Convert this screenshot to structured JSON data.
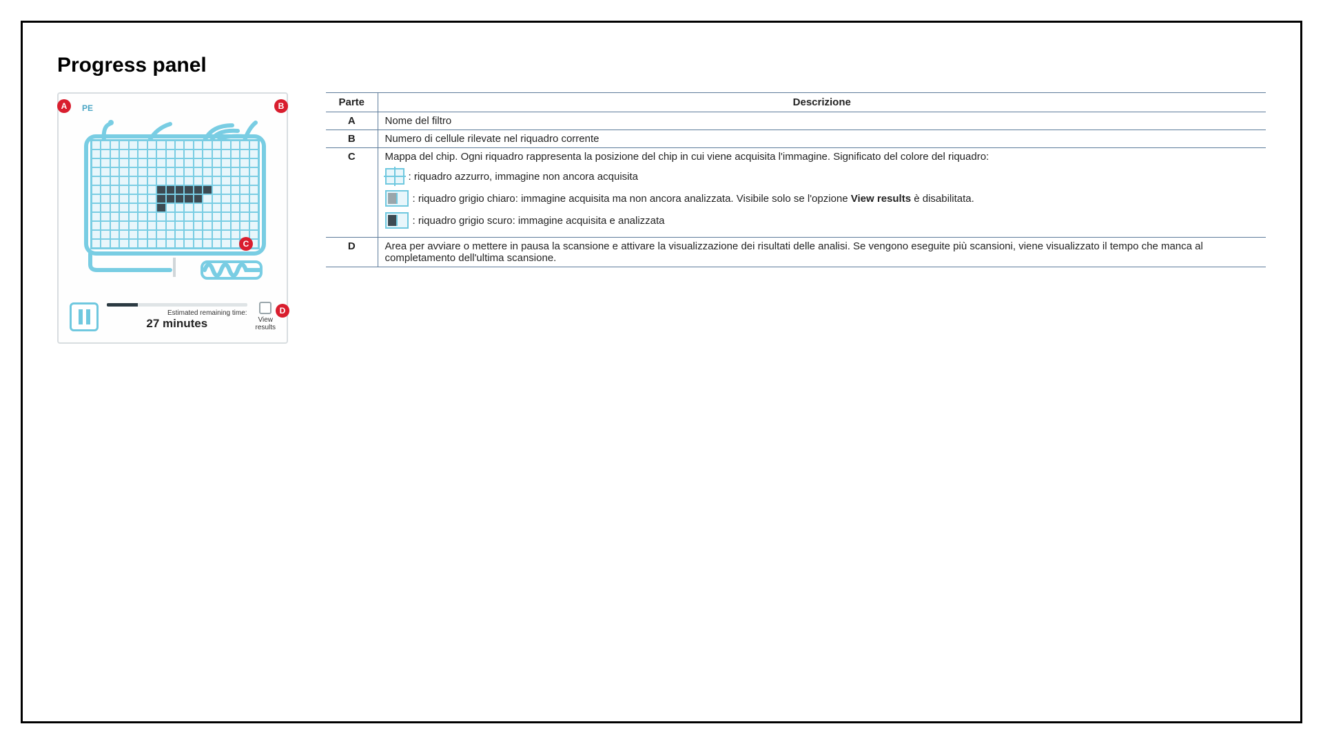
{
  "title": "Progress panel",
  "panel": {
    "filter_name": "PE",
    "estimated_label": "Estimated remaining time:",
    "estimated_value": "27 minutes",
    "view_results_label": "View\nresults"
  },
  "badges": {
    "a": "A",
    "b": "B",
    "c": "C",
    "d": "D"
  },
  "table": {
    "headers": {
      "part": "Parte",
      "desc": "Descrizione"
    },
    "rows": {
      "a": {
        "part": "A",
        "desc": "Nome del filtro"
      },
      "b": {
        "part": "B",
        "desc": "Numero di cellule rilevate nel riquadro corrente"
      },
      "c": {
        "part": "C",
        "intro": "Mappa del chip. Ogni riquadro rappresenta la posizione del chip in cui viene acquisita l'immagine. Significato del colore del riquadro:",
        "leg_azure": ": riquadro azzurro, immagine non ancora acquisita",
        "leg_light_prefix": ": riquadro grigio chiaro: immagine acquisita ma non ancora analizzata. Visibile solo se l'opzione ",
        "leg_light_bold": "View results",
        "leg_light_suffix": " è disabilitata.",
        "leg_dark": ": riquadro grigio scuro: immagine acquisita e analizzata"
      },
      "d": {
        "part": "D",
        "desc": "Area per avviare o mettere in pausa la scansione e attivare la visualizzazione dei risultati delle analisi. Se vengono eseguite più scansioni, viene visualizzato il tempo che manca al completamento dell'ultima scansione."
      }
    }
  }
}
